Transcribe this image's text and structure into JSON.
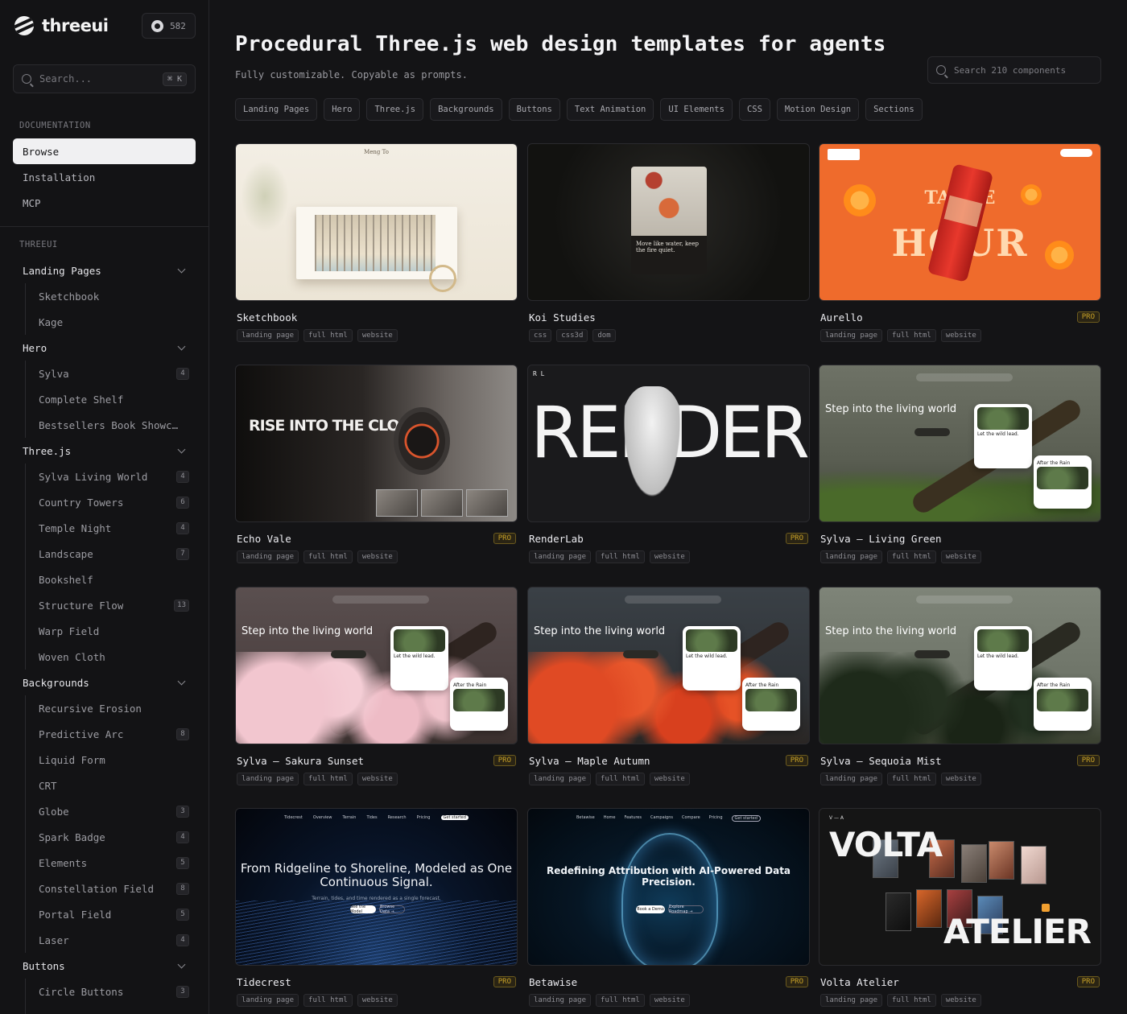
{
  "brand": {
    "name": "threeui",
    "github_stars": "582"
  },
  "sidebar": {
    "search_placeholder": "Search...",
    "search_shortcut": "⌘ K",
    "documentation_label": "DOCUMENTATION",
    "docs": [
      {
        "label": "Browse",
        "active": true
      },
      {
        "label": "Installation",
        "active": false
      },
      {
        "label": "MCP",
        "active": false
      }
    ],
    "threeui_label": "THREEUI",
    "groups": [
      {
        "label": "Landing Pages",
        "items": [
          {
            "label": "Sketchbook",
            "count": ""
          },
          {
            "label": "Kage",
            "count": ""
          }
        ]
      },
      {
        "label": "Hero",
        "items": [
          {
            "label": "Sylva",
            "count": "4"
          },
          {
            "label": "Complete Shelf",
            "count": ""
          },
          {
            "label": "Bestsellers Book Showca…",
            "count": ""
          }
        ]
      },
      {
        "label": "Three.js",
        "items": [
          {
            "label": "Sylva Living World",
            "count": "4"
          },
          {
            "label": "Country Towers",
            "count": "6"
          },
          {
            "label": "Temple Night",
            "count": "4"
          },
          {
            "label": "Landscape",
            "count": "7"
          },
          {
            "label": "Bookshelf",
            "count": ""
          },
          {
            "label": "Structure Flow",
            "count": "13"
          },
          {
            "label": "Warp Field",
            "count": ""
          },
          {
            "label": "Woven Cloth",
            "count": ""
          }
        ]
      },
      {
        "label": "Backgrounds",
        "items": [
          {
            "label": "Recursive Erosion",
            "count": ""
          },
          {
            "label": "Predictive Arc",
            "count": "8"
          },
          {
            "label": "Liquid Form",
            "count": ""
          },
          {
            "label": "CRT",
            "count": ""
          },
          {
            "label": "Globe",
            "count": "3"
          },
          {
            "label": "Spark Badge",
            "count": "4"
          },
          {
            "label": "Elements",
            "count": "5"
          },
          {
            "label": "Constellation Field",
            "count": "8"
          },
          {
            "label": "Portal Field",
            "count": "5"
          },
          {
            "label": "Laser",
            "count": "4"
          }
        ]
      },
      {
        "label": "Buttons",
        "items": [
          {
            "label": "Circle Buttons",
            "count": "3"
          }
        ]
      }
    ]
  },
  "main": {
    "title": "Procedural Three.js web design templates for agents",
    "subtitle": "Fully customizable. Copyable as prompts.",
    "search_placeholder": "Search 210 components",
    "chips": [
      "Landing Pages",
      "Hero",
      "Three.js",
      "Backgrounds",
      "Buttons",
      "Text Animation",
      "UI Elements",
      "CSS",
      "Motion Design",
      "Sections"
    ],
    "pro_label": "PRO",
    "cards": [
      {
        "title": "Sketchbook",
        "pro": false,
        "tags": [
          "landing page",
          "full html",
          "website"
        ]
      },
      {
        "title": "Koi Studies",
        "pro": false,
        "tags": [
          "css",
          "css3d",
          "dom"
        ]
      },
      {
        "title": "Aurello",
        "pro": true,
        "tags": [
          "landing page",
          "full html",
          "website"
        ]
      },
      {
        "title": "Echo Vale",
        "pro": true,
        "tags": [
          "landing page",
          "full html",
          "website"
        ]
      },
      {
        "title": "RenderLab",
        "pro": true,
        "tags": [
          "landing page",
          "full html",
          "website"
        ]
      },
      {
        "title": "Sylva — Living Green",
        "pro": false,
        "tags": [
          "landing page",
          "full html",
          "website"
        ]
      },
      {
        "title": "Sylva — Sakura Sunset",
        "pro": true,
        "tags": [
          "landing page",
          "full html",
          "website"
        ]
      },
      {
        "title": "Sylva — Maple Autumn",
        "pro": true,
        "tags": [
          "landing page",
          "full html",
          "website"
        ]
      },
      {
        "title": "Sylva — Sequoia Mist",
        "pro": true,
        "tags": [
          "landing page",
          "full html",
          "website"
        ]
      },
      {
        "title": "Tidecrest",
        "pro": true,
        "tags": [
          "landing page",
          "full html",
          "website"
        ]
      },
      {
        "title": "Betawise",
        "pro": true,
        "tags": [
          "landing page",
          "full html",
          "website"
        ]
      },
      {
        "title": "Volta Atelier",
        "pro": true,
        "tags": [
          "landing page",
          "full html",
          "website"
        ]
      }
    ]
  },
  "thumbs": {
    "sketch_name": "Meng To",
    "koi_quote": "Move like water, keep the fire quiet.",
    "aurello_top": "TANGE",
    "aurello_big": "HOUR",
    "echo_headline": "RISE INTO THE CLOUD.",
    "render_word": "RENDER",
    "render_logo": "R L",
    "sylva_headline": "Step into the living world",
    "sylva_card1": "Let the wild lead.",
    "sylva_card2": "After the Rain",
    "tide_brand": "Tidecrest",
    "tide_headline": "From Ridgeline to Shoreline, Modeled as One Continuous Signal.",
    "tide_sub": "Terrain, tides, and time rendered as a single forecast.",
    "tide_nav": [
      "Overview",
      "Terrain",
      "Tides",
      "Research",
      "Pricing"
    ],
    "tide_cta": "Get started",
    "tide_btn1": "See the Model",
    "tide_btn2": "Browse Data →",
    "beta_brand": "Betawise",
    "beta_headline": "Redefining Attribution with AI-Powered Data Precision.",
    "beta_nav": [
      "Home",
      "Features",
      "Campaigns",
      "Compare",
      "Pricing"
    ],
    "beta_cta": "Get started",
    "beta_btn1": "Book a Demo",
    "beta_btn2": "Explore Roadmap →",
    "volta_top": "VOLTA",
    "volta_bottom": "ATELIER",
    "volta_mark": "V — A"
  }
}
